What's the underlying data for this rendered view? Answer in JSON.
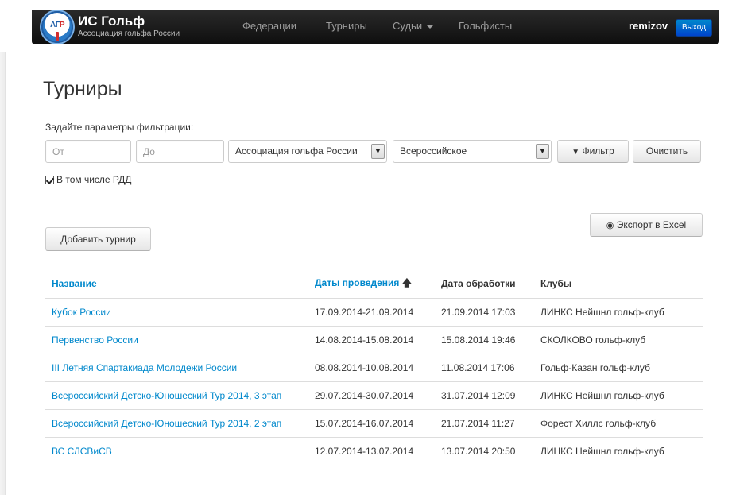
{
  "navbar": {
    "logo_text_a": "АГ",
    "logo_text_b": "Р",
    "brand_title": "ИС Гольф",
    "brand_subtitle": "Ассоциация гольфа России",
    "links": [
      "Федерации",
      "Турниры",
      "Судьи",
      "Гольфисты"
    ],
    "username": "remizov",
    "logout_label": "Выход"
  },
  "page": {
    "title": "Турниры",
    "filter_label": "Задайте параметры фильтрации:",
    "from_placeholder": "От",
    "to_placeholder": "До",
    "federation_select": "Ассоциация гольфа России",
    "level_select": "Всероссийское",
    "filter_button": "Фильтр",
    "clear_button": "Очистить",
    "include_rdd_label": "В том числе РДД",
    "add_button": "Добавить турнир",
    "export_button": "Экспорт в Excel"
  },
  "table": {
    "headers": {
      "name": "Название",
      "dates": "Даты проведения",
      "processed": "Дата обработки",
      "clubs": "Клубы"
    },
    "rows": [
      {
        "name": "Кубок России",
        "dates": "17.09.2014-21.09.2014",
        "processed": "21.09.2014 17:03",
        "clubs": "ЛИНКС Нейшнл гольф-клуб"
      },
      {
        "name": "Первенство России",
        "dates": "14.08.2014-15.08.2014",
        "processed": "15.08.2014 19:46",
        "clubs": "СКОЛКОВО гольф-клуб"
      },
      {
        "name": "III Летняя Спартакиада Молодежи России",
        "dates": "08.08.2014-10.08.2014",
        "processed": "11.08.2014 17:06",
        "clubs": "Гольф-Казан гольф-клуб"
      },
      {
        "name": "Всероссийский Детско-Юношеский Тур 2014, 3 этап",
        "dates": "29.07.2014-30.07.2014",
        "processed": "31.07.2014 12:09",
        "clubs": "ЛИНКС Нейшнл гольф-клуб"
      },
      {
        "name": "Всероссийский Детско-Юношеский Тур 2014, 2 этап",
        "dates": "15.07.2014-16.07.2014",
        "processed": "21.07.2014 11:27",
        "clubs": "Форест Хиллс гольф-клуб"
      },
      {
        "name": "ВС СЛСВиСВ",
        "dates": "12.07.2014-13.07.2014",
        "processed": "13.07.2014 20:50",
        "clubs": "ЛИНКС Нейшнл гольф-клуб"
      }
    ]
  }
}
